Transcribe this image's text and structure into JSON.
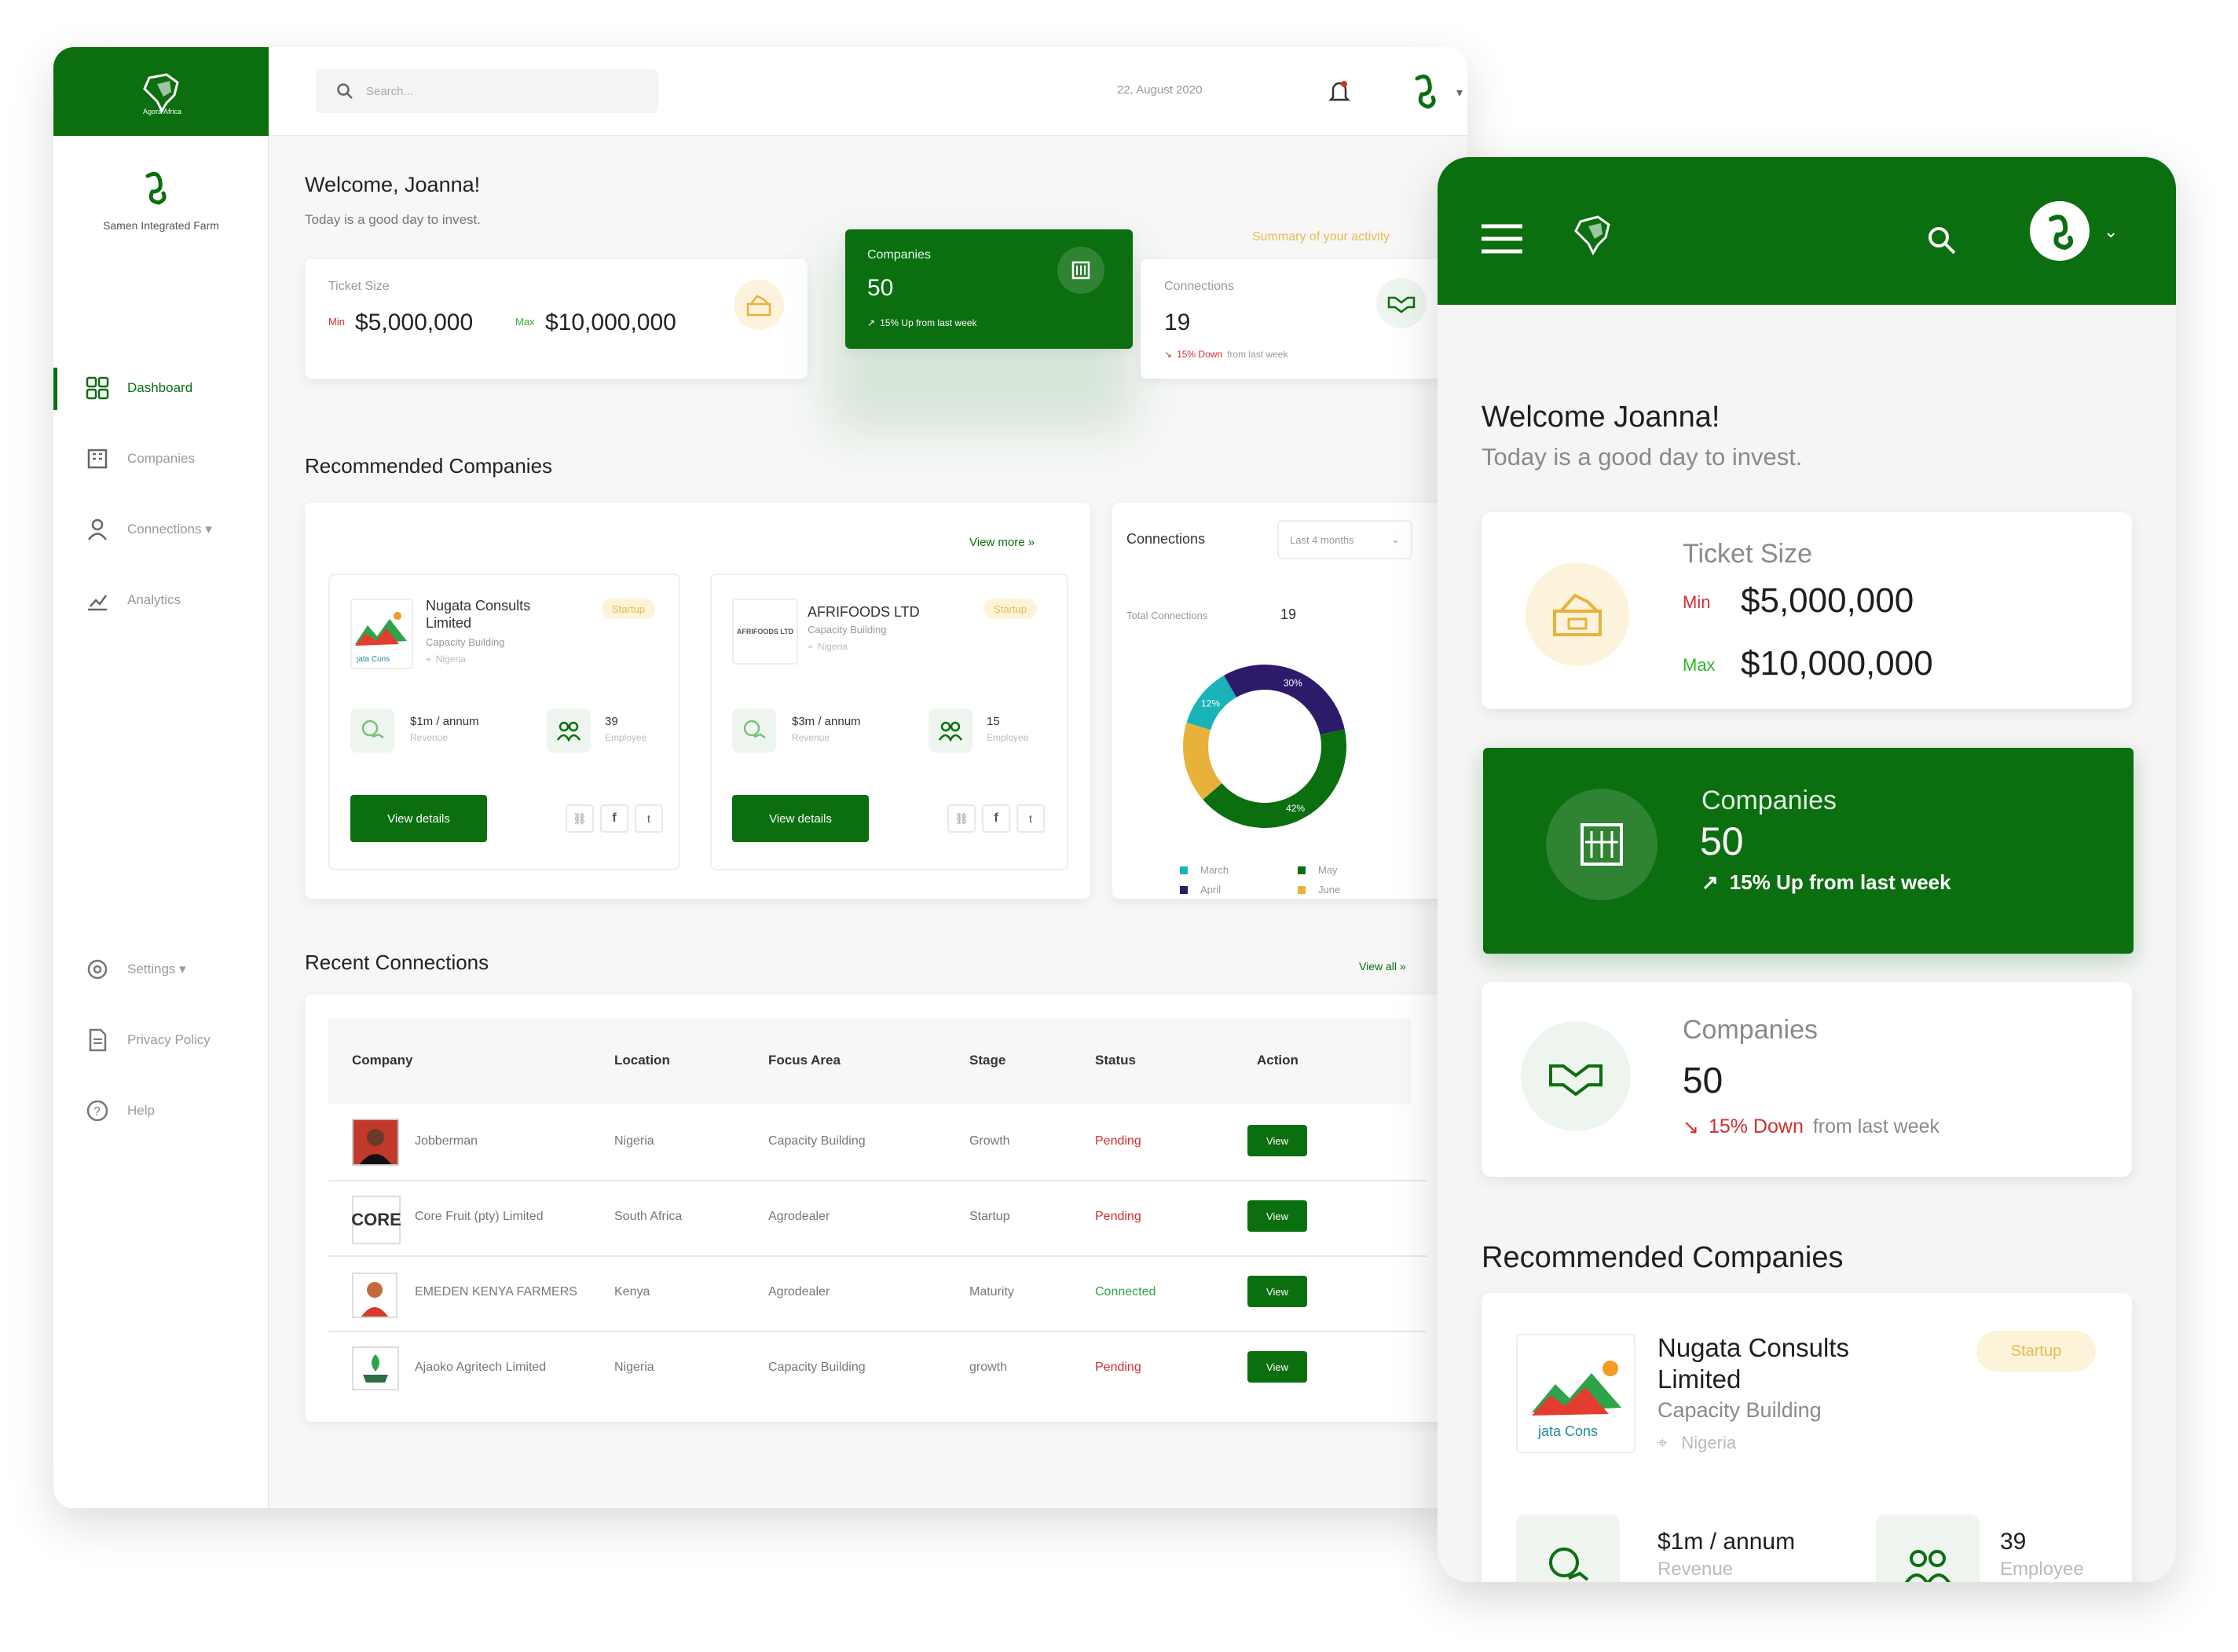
{
  "desktop": {
    "brand": {
      "logo_text": "Agora Africa",
      "user_name": "Samen Integrated Farm"
    },
    "search": {
      "placeholder": "Search..."
    },
    "date": "22, August 2020",
    "sidebar": {
      "items": [
        {
          "label": "Dashboard",
          "icon": "dashboard-icon",
          "active": true
        },
        {
          "label": "Companies",
          "icon": "companies-icon"
        },
        {
          "label": "Connections ▾",
          "icon": "user-icon"
        },
        {
          "label": "Analytics",
          "icon": "analytics-icon"
        }
      ],
      "bottom": [
        {
          "label": "Settings ▾",
          "icon": "gear-icon"
        },
        {
          "label": "Privacy Policy",
          "icon": "document-icon"
        },
        {
          "label": "Help",
          "icon": "help-icon"
        }
      ]
    },
    "welcome": {
      "title": "Welcome, Joanna!",
      "subtitle": "Today is a good day to invest."
    },
    "summary_link": "Summary of your activity",
    "ticket": {
      "label": "Ticket Size",
      "min_label": "Min",
      "min_value": "$5,000,000",
      "max_label": "Max",
      "max_value": "$10,000,000"
    },
    "companies_card": {
      "label": "Companies",
      "value": "50",
      "trend": "15% Up from last week"
    },
    "connections_card": {
      "label": "Connections",
      "value": "19",
      "trend_highlight": "15% Down",
      "trend_rest": "from last week"
    },
    "recommended": {
      "title": "Recommended Companies",
      "view_more": "View more »",
      "companies": [
        {
          "name": "Nugata Consults Limited",
          "area": "Capacity Building",
          "location": "Nigeria",
          "tag": "Startup",
          "revenue": "$1m / annum",
          "revenue_label": "Revenue",
          "employees": "39",
          "employees_label": "Employee",
          "button": "View details",
          "logo_text": "jata Cons"
        },
        {
          "name": "AFRIFOODS LTD",
          "area": "Capacity Building",
          "location": "Nigeria",
          "tag": "Startup",
          "revenue": "$3m / annum",
          "revenue_label": "Revenue",
          "employees": "15",
          "employees_label": "Employee",
          "button": "View details",
          "logo_text": "AFRIFOODS LTD"
        }
      ]
    },
    "connections_panel": {
      "title": "Connections",
      "filter": "Last 4 months",
      "total_label": "Total Connections",
      "total_value": "19",
      "legend": [
        {
          "label": "March",
          "color": "#1ab3b8"
        },
        {
          "label": "May",
          "color": "#0b6e0f"
        },
        {
          "label": "April",
          "color": "#2d1a6b"
        },
        {
          "label": "June",
          "color": "#e8b23a"
        }
      ]
    },
    "recent": {
      "title": "Recent Connections",
      "view_all": "View all »",
      "columns": [
        "Company",
        "Location",
        "Focus Area",
        "Stage",
        "Status",
        "Action"
      ],
      "rows": [
        {
          "company": "Jobberman",
          "location": "Nigeria",
          "focus": "Capacity Building",
          "stage": "Growth",
          "status": "Pending",
          "action": "View",
          "logo": "person"
        },
        {
          "company": "Core Fruit (pty) Limited",
          "location": "South Africa",
          "focus": "Agrodealer",
          "stage": "Startup",
          "status": "Pending",
          "action": "View",
          "logo": "CORE"
        },
        {
          "company": "EMEDEN KENYA FARMERS",
          "location": "Kenya",
          "focus": "Agrodealer",
          "stage": "Maturity",
          "status": "Connected",
          "action": "View",
          "logo": "person2"
        },
        {
          "company": "Ajaoko Agritech Limited",
          "location": "Nigeria",
          "focus": "Capacity Building",
          "stage": "growth",
          "status": "Pending",
          "action": "View",
          "logo": "agri"
        }
      ]
    }
  },
  "chart_data": {
    "type": "pie",
    "title": "Connections",
    "categories": [
      "March",
      "April",
      "May",
      "June"
    ],
    "values": [
      12,
      30,
      42,
      16
    ],
    "labels": [
      "12%",
      "30%",
      "42%",
      ""
    ],
    "colors": [
      "#1ab3b8",
      "#2d1a6b",
      "#0b6e0f",
      "#e8b23a"
    ]
  },
  "mobile": {
    "welcome": {
      "title": "Welcome Joanna!",
      "subtitle": "Today is a good day to invest."
    },
    "ticket": {
      "label": "Ticket Size",
      "min_label": "Min",
      "min_value": "$5,000,000",
      "max_label": "Max",
      "max_value": "$10,000,000"
    },
    "companies_card": {
      "label": "Companies",
      "value": "50",
      "trend": "15% Up from last week"
    },
    "companies_card2": {
      "label": "Companies",
      "value": "50",
      "trend_highlight": "15% Down",
      "trend_rest": "from last week"
    },
    "recommended_title": "Recommended Companies",
    "company": {
      "name_line1": "Nugata Consults",
      "name_line2": "Limited",
      "area": "Capacity Building",
      "location": "Nigeria",
      "tag": "Startup",
      "revenue": "$1m / annum",
      "revenue_label": "Revenue",
      "employees": "39",
      "employees_label": "Employee",
      "logo_text": "jata Cons"
    }
  }
}
